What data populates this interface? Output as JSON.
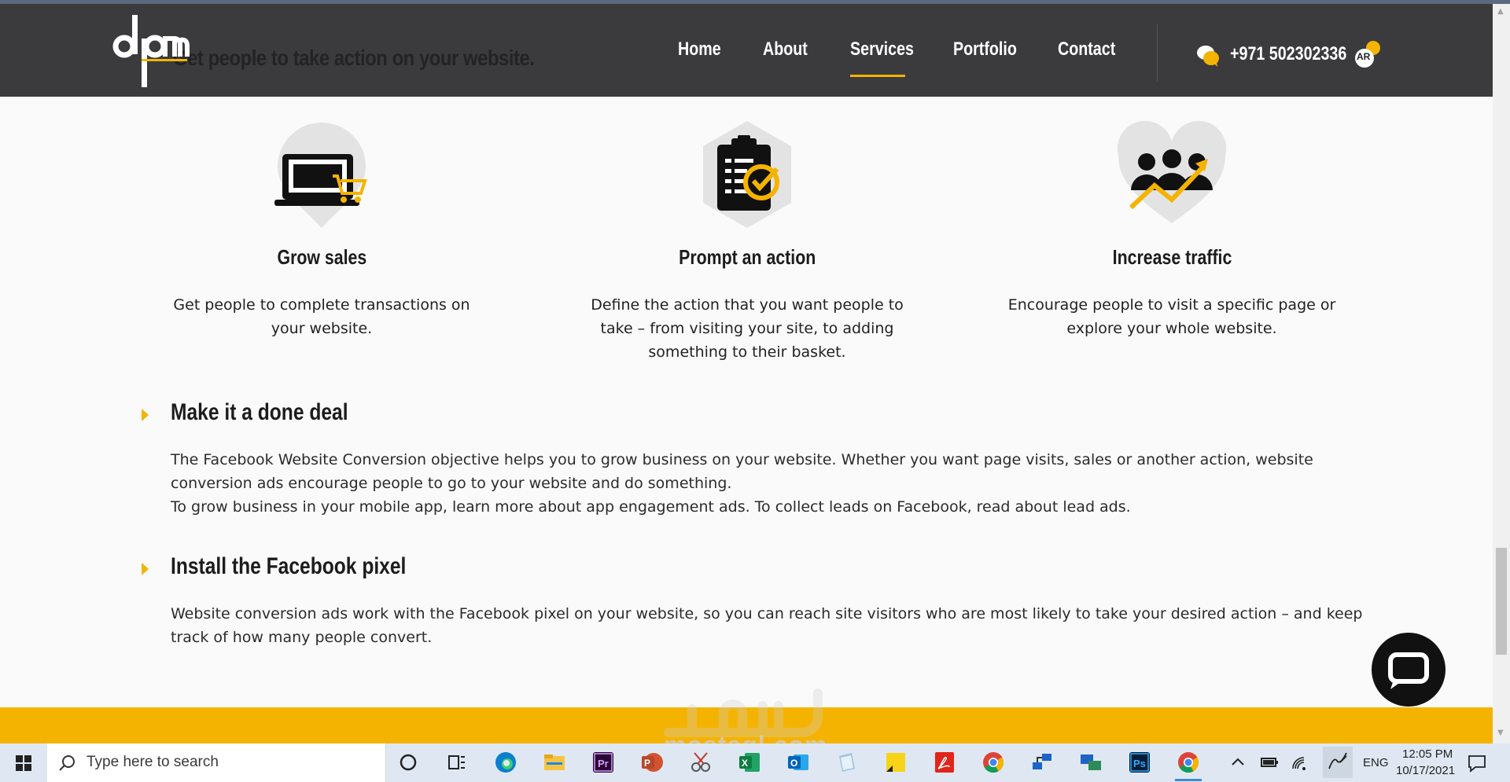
{
  "header": {
    "logo_text": "dpm",
    "obscured_heading": "Get people to take action on your website.",
    "nav": [
      {
        "label": "Home"
      },
      {
        "label": "About"
      },
      {
        "label": "Services",
        "active": true
      },
      {
        "label": "Portfolio"
      },
      {
        "label": "Contact"
      }
    ],
    "phone": "+971 502302336",
    "lang_button": "AR"
  },
  "features": [
    {
      "icon": "laptop-cart-icon",
      "title": "Grow sales",
      "description": "Get people to complete transactions on your website."
    },
    {
      "icon": "clipboard-check-icon",
      "title": "Prompt an action",
      "description": "Define the action that you want people to take – from visiting your site, to adding something to their basket."
    },
    {
      "icon": "people-growth-icon",
      "title": "Increase traffic",
      "description": "Encourage people to visit a specific page or explore your whole website."
    }
  ],
  "accordions": [
    {
      "title": "Make it a done deal",
      "paragraphs": [
        "The Facebook Website Conversion objective helps you to grow business on your website. Whether you want page visits, sales or another action, website conversion ads encourage people to go to your website and do something.",
        "To grow business in your mobile app, learn more about app engagement ads. To collect leads on Facebook, read about lead ads."
      ]
    },
    {
      "title": "Install the Facebook pixel",
      "paragraphs": [
        "Website conversion ads work with the Facebook pixel on your website, so you can reach site visitors who are most likely to take your desired action – and keep track of how many people convert."
      ]
    }
  ],
  "watermark": {
    "text": "mostaql.com",
    "arabic": "مستقل"
  },
  "taskbar": {
    "search_placeholder": "Type here to search",
    "apps": [
      "cortana-icon",
      "task-view-icon",
      "edge-icon",
      "file-explorer-icon",
      "premiere-icon",
      "powerpoint-icon",
      "snipping-icon",
      "excel-icon",
      "outlook-icon",
      "notepad-icon",
      "sticky-notes-icon",
      "acrobat-icon",
      "chrome-icon",
      "network-icon",
      "remote-icon",
      "photoshop-icon",
      "chrome-icon"
    ],
    "language": "ENG",
    "time": "12:05 PM",
    "date": "10/17/2021"
  },
  "colors": {
    "accent": "#f5b301",
    "header_bg": "#3b3b3d",
    "page_bg": "#fafafa"
  }
}
